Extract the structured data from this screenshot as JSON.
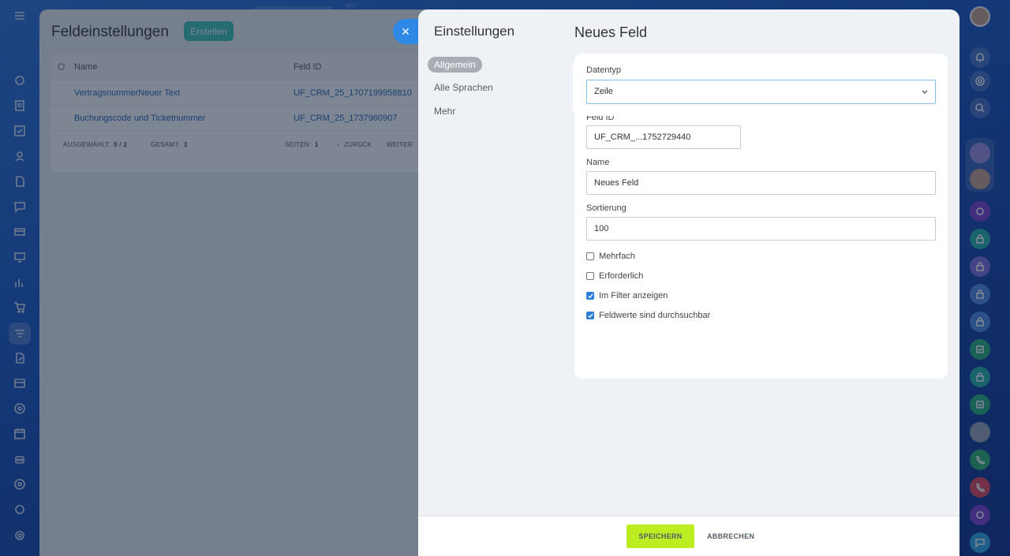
{
  "colors": {
    "accent": "#2e88e6",
    "save": "#bbed21",
    "create": "#3bc8b4",
    "link": "#2067b0",
    "checkbox": "#2d7ed6"
  },
  "top_hint": {
    "new_badge": "NEU"
  },
  "left_rail": {
    "icons": [
      "menu-icon",
      "sync-icon",
      "document-icon",
      "task-icon",
      "contacts-icon",
      "file-icon",
      "chat-icon",
      "card-icon",
      "monitor-icon",
      "analytics-icon",
      "cart-icon",
      "funnel-icon",
      "edit-doc-icon",
      "payment-icon",
      "shield-icon",
      "calendar-icon",
      "robot-icon",
      "target-icon",
      "badge-icon",
      "settings-icon"
    ]
  },
  "back_panel": {
    "title": "Feldeinstellungen",
    "create_label": "Erstellen",
    "columns": [
      "Name",
      "Feld ID"
    ],
    "rows": [
      {
        "name": "VertragsnummerNeuer Text",
        "id": "UF_CRM_25_1707199958810"
      },
      {
        "name": "Buchungscode und Ticketnummer",
        "id": "UF_CRM_25_1737960907"
      }
    ],
    "footer": {
      "selected_label": "Ausgewählt:",
      "selected": "0 / 2",
      "total_label": "Gesamt:",
      "total": "2",
      "pages_label": "Seiten:",
      "pages": "1",
      "prev": "Zurück",
      "next": "Weiter"
    }
  },
  "slider": {
    "title": "Einstellungen",
    "nav": [
      "Allgemein",
      "Alle Sprachen",
      "Mehr"
    ],
    "form_title": "Neues Feld",
    "datatype": {
      "label": "Datentyp",
      "value": "Zeile"
    },
    "field_id": {
      "label": "Feld ID",
      "value": "UF_CRM_...1752729440"
    },
    "name": {
      "label": "Name",
      "value": "Neues Feld"
    },
    "sort": {
      "label": "Sortierung",
      "value": "100"
    },
    "checkboxes": [
      {
        "label": "Mehrfach",
        "checked": false
      },
      {
        "label": "Erforderlich",
        "checked": false
      },
      {
        "label": "Im Filter anzeigen",
        "checked": true
      },
      {
        "label": "Feldwerte sind durchsuchbar",
        "checked": true
      }
    ],
    "save_label": "Speichern",
    "cancel_label": "Abbrechen"
  },
  "right_rail": {
    "items": [
      "user-avatar",
      "bell-icon",
      "target-icon",
      "search-chat-icon",
      "chat-avatar",
      "user-avatar-2",
      "channel-icon",
      "lock-icon",
      "lock-icon",
      "lock-icon",
      "lock-icon",
      "task-icon",
      "lock-icon",
      "task-icon",
      "user-avatar-3",
      "phone-icon",
      "phone-icon",
      "channel-icon",
      "chat-icon"
    ]
  }
}
